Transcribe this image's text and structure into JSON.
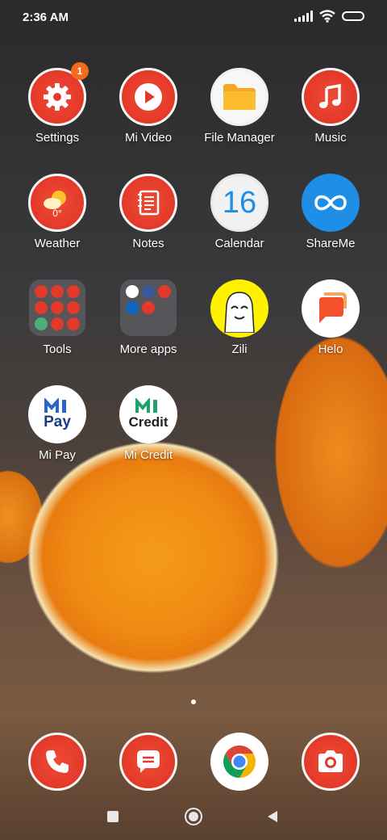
{
  "status_bar": {
    "time": "2:36 AM"
  },
  "apps": {
    "settings": {
      "label": "Settings",
      "badge": "1"
    },
    "mi_video": {
      "label": "Mi Video"
    },
    "file_manager": {
      "label": "File Manager"
    },
    "music": {
      "label": "Music"
    },
    "weather": {
      "label": "Weather",
      "temp": "0°"
    },
    "notes": {
      "label": "Notes"
    },
    "calendar": {
      "label": "Calendar",
      "day": "16"
    },
    "shareme": {
      "label": "ShareMe"
    },
    "tools": {
      "label": "Tools"
    },
    "more_apps": {
      "label": "More apps"
    },
    "zili": {
      "label": "Zili"
    },
    "helo": {
      "label": "Helo"
    },
    "mi_pay": {
      "label": "Mi Pay",
      "logo_word": "Pay"
    },
    "mi_credit": {
      "label": "Mi Credit",
      "logo_word": "Credit"
    }
  },
  "dock": {
    "items": [
      "phone-icon",
      "messaging-icon",
      "chrome-icon",
      "camera-icon"
    ]
  },
  "colors": {
    "accent_red": "#e3392a",
    "badge": "#f26b1f",
    "shareme_blue": "#1e8ee6"
  }
}
